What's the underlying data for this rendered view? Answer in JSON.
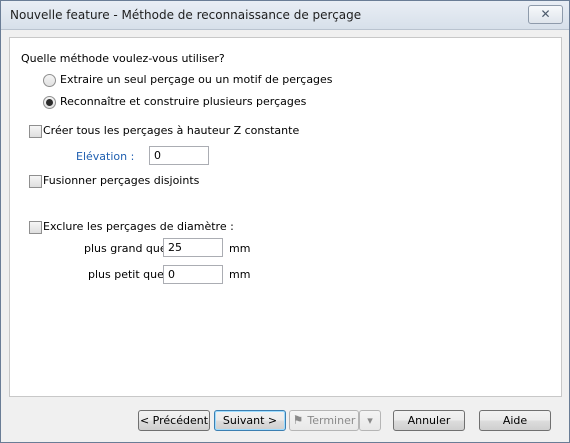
{
  "window": {
    "title": "Nouvelle feature - Méthode de reconnaissance de perçage",
    "close_symbol": "✕"
  },
  "question": "Quelle méthode voulez-vous utiliser?",
  "methods": [
    {
      "label": "Extraire un seul perçage ou un motif de perçages",
      "selected": false
    },
    {
      "label": "Reconnaître et construire plusieurs perçages",
      "selected": true
    }
  ],
  "constant_z": {
    "label": "Créer tous les perçages à hauteur Z constante",
    "checked": false,
    "elevation_label": "Elévation :",
    "elevation_value": "0"
  },
  "merge": {
    "label": "Fusionner perçages disjoints",
    "checked": false
  },
  "exclude": {
    "label": "Exclure les perçages de diamètre :",
    "checked": false,
    "greater_label": "plus grand que",
    "greater_value": "25",
    "smaller_label": "plus petit que",
    "smaller_value": "0",
    "unit": "mm"
  },
  "buttons": {
    "previous": "< Précédent",
    "next": "Suivant >",
    "finish": "Terminer",
    "finish_icon": "checkered-flag-icon",
    "dropdown_symbol": "▾",
    "cancel": "Annuler",
    "help": "Aide"
  },
  "colors": {
    "accent": "#1f5fb0",
    "default_button_border": "#3c7fb1"
  }
}
